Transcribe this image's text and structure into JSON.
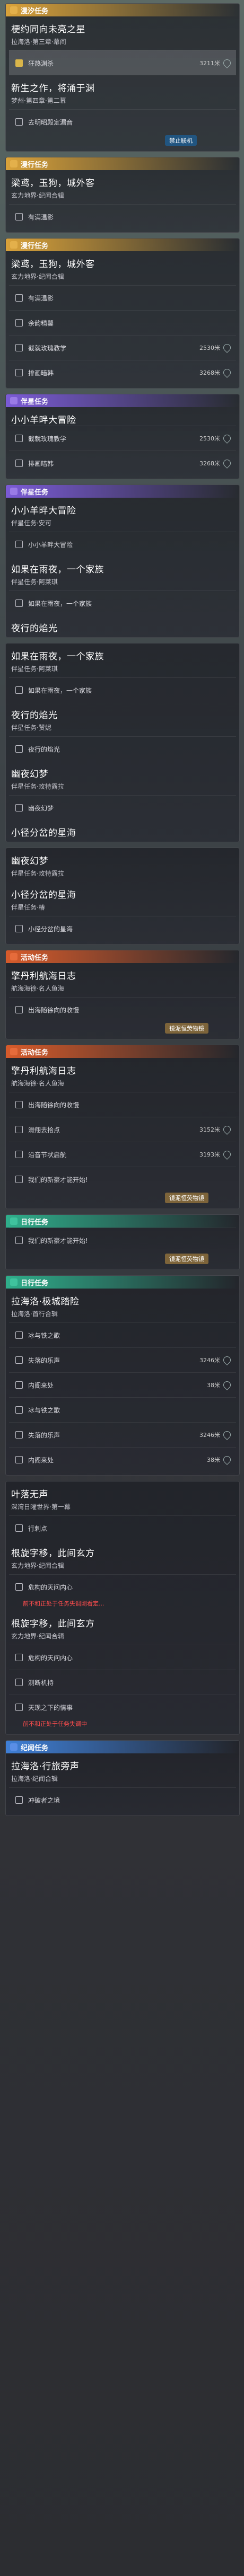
{
  "badges": {
    "ban_machine": "禁止联机",
    "merge_item": "镜泥恒荧物镜"
  },
  "sections": [
    {
      "kind": "flow",
      "label": "漫汐任务",
      "cards": [
        {
          "title": "梗约同向未亮之星",
          "sub": "拉海洛·第三章·幕间",
          "rows": [
            {
              "t": "狂热渊杀",
              "d": "3211米",
              "active": true
            }
          ]
        },
        {
          "title": "新生之作，将涌于渊",
          "sub": "梦州·第四章·第二幕",
          "rows": [
            {
              "t": "去明昭殿定漏音",
              "d": ""
            }
          ],
          "badge": "ban_machine"
        }
      ]
    },
    {
      "kind": "flow",
      "label": "漫行任务",
      "cards": [
        {
          "title": "梁鸢，玉狗，城外客",
          "sub": "玄力地界·纪闻合辑",
          "rows": [
            {
              "t": "有满温影",
              "d": ""
            }
          ]
        }
      ]
    },
    {
      "kind": "flow",
      "label": "漫行任务",
      "cards": [
        {
          "title": "梁鸢，玉狗，城外客",
          "sub": "玄力地界·纪闻合辑",
          "rows": [
            {
              "t": "有满温影",
              "d": ""
            },
            {
              "t": "余韵精馨",
              "d": ""
            },
            {
              "t": "截就玫瑰教学",
              "d": "2530米"
            },
            {
              "t": "排画暗韩",
              "d": "3268米"
            }
          ]
        }
      ]
    },
    {
      "kind": "comp",
      "label": "伴星任务",
      "cards": [
        {
          "title": "小小羊畔大冒险",
          "sub": "",
          "rows": [
            {
              "t": "截就玫瑰教学",
              "d": "2530米"
            },
            {
              "t": "排画暗韩",
              "d": "3268米"
            }
          ]
        }
      ]
    },
    {
      "kind": "comp",
      "label": "伴星任务",
      "cards": [
        {
          "title": "小小羊畔大冒险",
          "sub": "伴星任务·安可",
          "rows": [
            {
              "t": "小小羊畔大冒险",
              "d": ""
            }
          ]
        },
        {
          "title": "如果在雨夜，一个家族",
          "sub": "伴星任务·阿莱琪",
          "rows": [
            {
              "t": "如果在雨夜，一个家族",
              "d": ""
            }
          ]
        },
        {
          "title": "夜行的焰光",
          "sub": "",
          "rows": []
        }
      ]
    },
    {
      "kind": "comp",
      "label": "",
      "cards": [
        {
          "title": "如果在雨夜，一个家族",
          "sub": "伴星任务·阿莱琪",
          "rows": [
            {
              "t": "如果在雨夜，一个家族",
              "d": ""
            }
          ]
        },
        {
          "title": "夜行的焰光",
          "sub": "伴星任务·赞妮",
          "rows": [
            {
              "t": "夜行的焰光",
              "d": ""
            }
          ]
        },
        {
          "title": "幽夜幻梦",
          "sub": "伴星任务·玫特露拉",
          "rows": [
            {
              "t": "幽夜幻梦",
              "d": ""
            }
          ]
        },
        {
          "title": "小径分岔的星海",
          "sub": "",
          "rows": []
        }
      ]
    },
    {
      "kind": "comp",
      "label": "",
      "cards": [
        {
          "title": "幽夜幻梦",
          "sub": "伴星任务·玫特露拉",
          "rows": []
        },
        {
          "title": "小径分岔的星海",
          "sub": "伴星任务·椿",
          "rows": [
            {
              "t": "小径分岔的星海",
              "d": ""
            }
          ]
        }
      ]
    },
    {
      "kind": "act",
      "label": "活动任务",
      "cards": [
        {
          "title": "擎丹利航海日志",
          "sub": "航海海徐·名人鱼海",
          "rows": [
            {
              "t": "出海随徐向的收慢",
              "d": ""
            }
          ],
          "badge": "merge_item"
        }
      ]
    },
    {
      "kind": "act",
      "label": "活动任务",
      "cards": [
        {
          "title": "擎丹利航海日志",
          "sub": "航海海徐·名人鱼海",
          "rows": [
            {
              "t": "出海随徐向的收慢",
              "d": ""
            },
            {
              "t": "滑翔去拾点",
              "d": "3152米"
            },
            {
              "t": "沿音节状启航",
              "d": "3193米"
            },
            {
              "t": "我们的新豪才能开始!",
              "d": ""
            }
          ],
          "badge": "merge_item"
        }
      ]
    },
    {
      "kind": "daily",
      "label": "日行任务",
      "cards": [
        {
          "title": "",
          "sub": "",
          "rows": [
            {
              "t": "我们的新豪才能开始!",
              "d": ""
            }
          ],
          "badge": "merge_item"
        }
      ]
    },
    {
      "kind": "daily",
      "label": "日行任务",
      "cards": [
        {
          "title": "拉海洛·极城踏险",
          "sub": "拉海洛·首行合辑",
          "rows": [
            {
              "t": "冰与铁之歌",
              "d": ""
            },
            {
              "t": "失落的乐声",
              "d": "3246米"
            },
            {
              "t": "内阁来处",
              "d": "38米"
            },
            {
              "t": "冰与铁之歌",
              "d": ""
            },
            {
              "t": "失落的乐声",
              "d": "3246米"
            },
            {
              "t": "内阁来处",
              "d": "38米"
            }
          ]
        }
      ]
    },
    {
      "kind": "daily",
      "label": "",
      "cards": [
        {
          "title": "叶落无声",
          "sub": "深湾日曜世界·第一幕",
          "rows": [
            {
              "t": "行刺点",
              "d": ""
            }
          ]
        },
        {
          "title": "根旋字移，此间玄方",
          "sub": "玄力地界·纪闻合辑",
          "rows": [
            {
              "t": "危构的天问内心",
              "d": ""
            }
          ],
          "warn": "前不和正处于任务失调刚看定..."
        },
        {
          "title": "根旋字移，此间玄方",
          "sub": "玄力地界·纪闻合辑",
          "rows": [
            {
              "t": "危构的天问内心",
              "d": ""
            },
            {
              "t": "测断机持",
              "d": ""
            },
            {
              "t": "天现之下的情事",
              "d": ""
            }
          ],
          "warn": "前不和正处于任务失调中"
        }
      ]
    },
    {
      "kind": "world",
      "label": "纪闻任务",
      "cards": [
        {
          "title": "拉海洛·行旅旁声",
          "sub": "拉海洛·纪闻合辑",
          "rows": [
            {
              "t": "冲破者之境",
              "d": ""
            }
          ]
        }
      ]
    }
  ]
}
